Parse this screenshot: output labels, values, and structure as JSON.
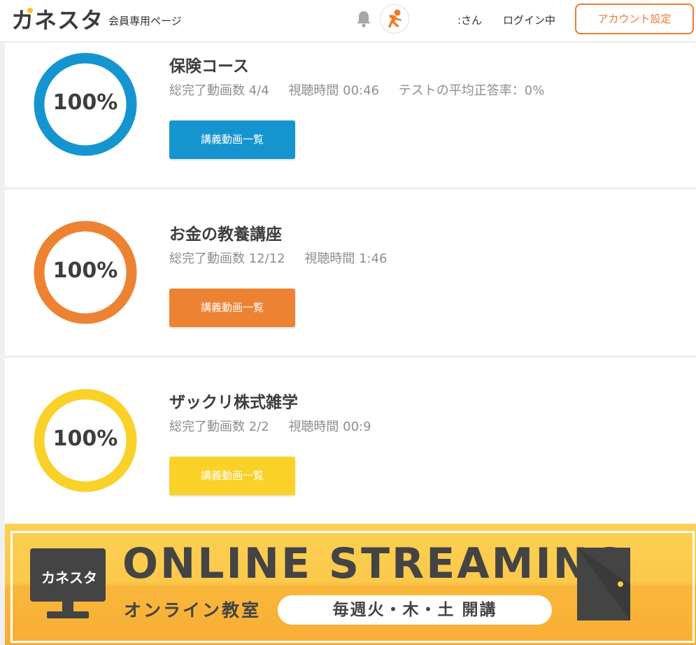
{
  "header": {
    "logo": "カネスタ",
    "subtitle": "会員専用ページ",
    "user_name": ":さん",
    "login_status": "ログイン中",
    "account_button": "アカウント設定"
  },
  "courses": [
    {
      "progress": "100%",
      "title": "保険コース",
      "videos": "総完了動画数 4/4",
      "watch_time": "視聴時間 00:46",
      "test_rate": "テストの平均正答率：0%",
      "button": "講義動画一覧",
      "color": "#1595d0"
    },
    {
      "progress": "100%",
      "title": "お金の教養講座",
      "videos": "総完了動画数 12/12",
      "watch_time": "視聴時間 1:46",
      "button": "講義動画一覧",
      "color": "#ee8233"
    },
    {
      "progress": "100%",
      "title": "ザックリ株式雑学",
      "videos": "総完了動画数 2/2",
      "watch_time": "視聴時間 00:9",
      "button": "講義動画一覧",
      "color": "#fad129"
    }
  ],
  "banner": {
    "logo": "カネスタ",
    "title": "ONLINE STREAMING",
    "subtitle": "オンライン教室",
    "schedule": "毎週火・木・土 開講"
  },
  "colors": {
    "accent": "#ee7b2e",
    "text_dark": "#3d3d3d",
    "text_muted": "#8e8e8e"
  }
}
